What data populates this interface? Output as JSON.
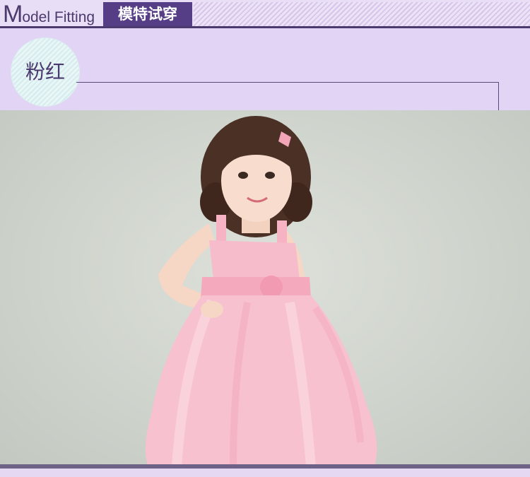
{
  "header": {
    "title_initial": "M",
    "title_rest": "odel Fitting",
    "tag": "模特试穿"
  },
  "section": {
    "color_label": "粉红"
  },
  "photo": {
    "subject": "girl-in-pink-dress"
  },
  "colors": {
    "header_tag_bg": "#563e86",
    "band_bg": "#e1d4f4",
    "dress_pink": "#f7b8c8"
  }
}
